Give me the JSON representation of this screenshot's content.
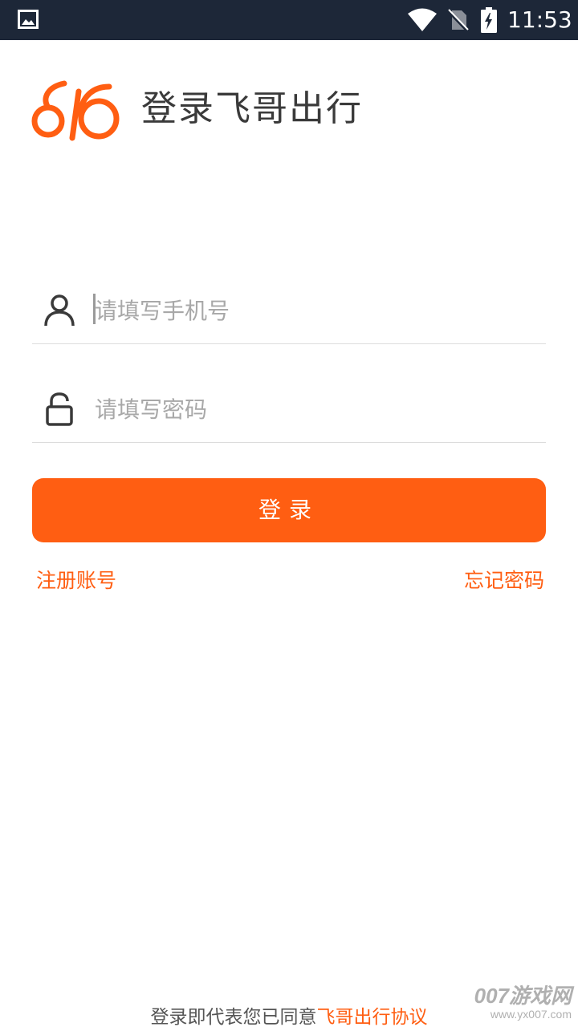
{
  "status_bar": {
    "time": "11:53",
    "icons": [
      "image-icon",
      "wifi-icon",
      "no-sim-icon",
      "battery-charging-icon"
    ]
  },
  "header": {
    "logo_icon": "feige-logo-icon",
    "title": "登录飞哥出行"
  },
  "form": {
    "phone_placeholder": "请填写手机号",
    "phone_icon": "user-icon",
    "password_placeholder": "请填写密码",
    "password_icon": "unlock-icon",
    "login_label": "登录"
  },
  "links": {
    "register": "注册账号",
    "forgot_password": "忘记密码"
  },
  "footer": {
    "agreement_prefix": "登录即代表您已同意",
    "agreement_link": "飞哥出行协议"
  },
  "watermark": {
    "main": "007游戏网",
    "sub": "www.yx007.com"
  },
  "colors": {
    "accent": "#ff5e12",
    "status_bar": "#1d2738",
    "title_text": "#3a3a3a",
    "placeholder": "#a8a8a8"
  }
}
